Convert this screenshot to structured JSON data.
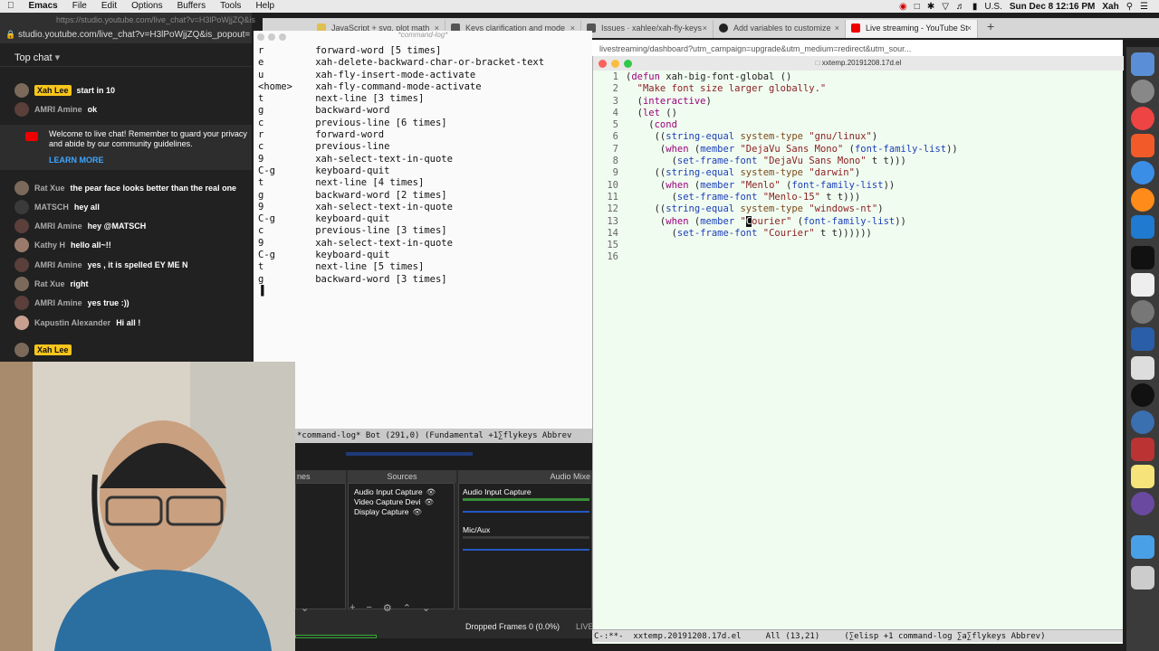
{
  "menubar": {
    "apple": "",
    "app": "Emacs",
    "items": [
      "File",
      "Edit",
      "Options",
      "Buffers",
      "Tools",
      "Help"
    ],
    "input_source": "U.S.",
    "clock": "Sun Dec 8  12:16 PM",
    "user": "Xah"
  },
  "browser_tabs": [
    {
      "label": "JavaScript + svg. plot math",
      "active": false
    },
    {
      "label": "Keys clarification and mode",
      "active": false
    },
    {
      "label": "Issues · xahlee/xah-fly-keys",
      "active": false
    },
    {
      "label": "Add variables to customize",
      "active": false
    },
    {
      "label": "Live streaming - YouTube St",
      "active": true
    }
  ],
  "browser": {
    "new_tab": "+",
    "address": "livestreaming/dashboard?utm_campaign=upgrade&utm_medium=redirect&utm_sour..."
  },
  "youtube": {
    "url_gray": "https://studio.youtube.com/live_chat?v=H3lPoWjjZQ&is",
    "url": "studio.youtube.com/live_chat?v=H3lPoWjjZQ&is_popout=",
    "header": "Top chat",
    "messages_top": [
      {
        "author": "Xah Lee",
        "text": "start in 10",
        "owner": true
      },
      {
        "author": "AMRI Amine",
        "text": "ok",
        "owner": false
      }
    ],
    "welcome": "Welcome to live chat! Remember to guard your privacy and abide by our community guidelines.",
    "learn_more": "LEARN MORE",
    "messages": [
      {
        "author": "Rat Xue",
        "text": "the pear face looks better than the real one",
        "owner": false
      },
      {
        "author": "MATSCH",
        "text": "hey all",
        "owner": false
      },
      {
        "author": "AMRI Amine",
        "text": "hey @MATSCH",
        "owner": false
      },
      {
        "author": "Kathy H",
        "text": "hello all~!!",
        "owner": false
      },
      {
        "author": "AMRI Amine",
        "text": "yes , it is spelled EY ME N",
        "owner": false
      },
      {
        "author": "Rat Xue",
        "text": "right",
        "owner": false
      },
      {
        "author": "AMRI Amine",
        "text": "yes true :))",
        "owner": false
      },
      {
        "author": "Kapustin Alexander",
        "text": "Hi all !",
        "owner": false
      }
    ],
    "input_author": "Xah Lee"
  },
  "cmdlog": {
    "title": "*command-log*",
    "lines": [
      [
        "r",
        "forward-word [5 times]"
      ],
      [
        "e",
        "xah-delete-backward-char-or-bracket-text"
      ],
      [
        "u",
        "xah-fly-insert-mode-activate"
      ],
      [
        "<home>",
        "xah-fly-command-mode-activate"
      ],
      [
        "t",
        "next-line [3 times]"
      ],
      [
        "g",
        "backward-word"
      ],
      [
        "c",
        "previous-line [6 times]"
      ],
      [
        "r",
        "forward-word"
      ],
      [
        "c",
        "previous-line"
      ],
      [
        "9",
        "xah-select-text-in-quote"
      ],
      [
        "C-g",
        "keyboard-quit"
      ],
      [
        "t",
        "next-line [4 times]"
      ],
      [
        "g",
        "backward-word [2 times]"
      ],
      [
        "9",
        "xah-select-text-in-quote"
      ],
      [
        "C-g",
        "keyboard-quit"
      ],
      [
        "c",
        "previous-line [3 times]"
      ],
      [
        "9",
        "xah-select-text-in-quote"
      ],
      [
        "C-g",
        "keyboard-quit"
      ],
      [
        "t",
        "next-line [5 times]"
      ],
      [
        "g",
        "backward-word [3 times]"
      ]
    ],
    "modeline": "*command-log*   Bot (291,0)    (Fundamental +1∑flykeys Abbrev"
  },
  "emacs": {
    "title": "xxtemp.20191208.17d.el",
    "modeline": "C-:**-  xxtemp.20191208.17d.el     All (13,21)     (∑elisp +1 command-log ∑a∑flykeys Abbrev)"
  },
  "obs": {
    "scenes_header": "nes",
    "sources_header": "Sources",
    "mixer_header": "Audio Mixe",
    "sources": [
      "Audio Input Capture",
      "Video Capture Devi",
      "Display Capture"
    ],
    "mixer": [
      "Audio Input Capture",
      "Mic/Aux"
    ],
    "dropped": "Dropped Frames 0 (0.0%)",
    "live": "LIVE"
  }
}
